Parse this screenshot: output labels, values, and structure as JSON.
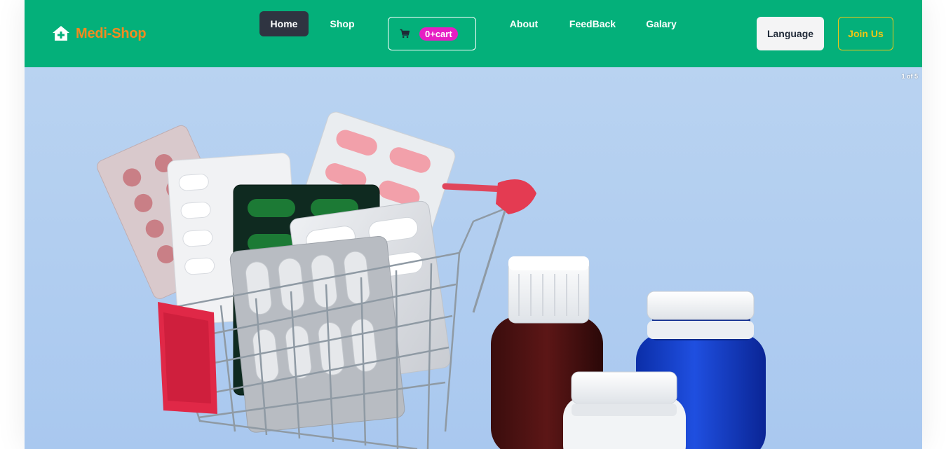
{
  "brand": {
    "name": "Medi-Shop",
    "icon": "home-plus-icon"
  },
  "nav": {
    "home": "Home",
    "shop": "Shop",
    "about": "About",
    "feedback": "FeedBack",
    "galary": "Galary"
  },
  "cart": {
    "icon": "shopping-cart-icon",
    "label": "0+cart",
    "count": 0
  },
  "actions": {
    "language": "Language",
    "join": "Join Us"
  },
  "hero": {
    "slide_counter": "1 of 5",
    "image": "shopping-cart-with-medicine-pills-and-bottles"
  },
  "colors": {
    "navbar": "#04b07a",
    "brand_text": "#f58a1f",
    "active_nav": "#2f3441",
    "cart_badge": "#e61ec3",
    "join_accent": "#f3c613",
    "hero_background": "#b3cef0"
  }
}
